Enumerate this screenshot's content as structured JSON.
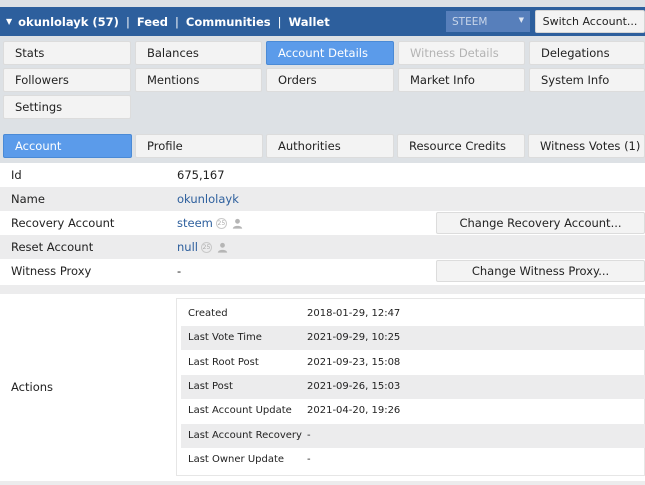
{
  "topbar": {
    "account": "okunlolayk (57)",
    "links": [
      "Feed",
      "Communities",
      "Wallet"
    ],
    "chain": "STEEM",
    "switch_label": "Switch Account..."
  },
  "nav": {
    "tabs": [
      {
        "label": "Stats"
      },
      {
        "label": "Balances"
      },
      {
        "label": "Account Details"
      },
      {
        "label": "Witness Details"
      },
      {
        "label": "Delegations"
      },
      {
        "label": "Followers"
      },
      {
        "label": "Mentions"
      },
      {
        "label": "Orders"
      },
      {
        "label": "Market Info"
      },
      {
        "label": "System Info"
      },
      {
        "label": "Settings"
      }
    ]
  },
  "subtabs": [
    {
      "label": "Account"
    },
    {
      "label": "Profile"
    },
    {
      "label": "Authorities"
    },
    {
      "label": "Resource Credits"
    },
    {
      "label": "Witness Votes (1)"
    }
  ],
  "details": {
    "id_label": "Id",
    "id_value": "675,167",
    "name_label": "Name",
    "name_value": "okunlolayk",
    "recovery_label": "Recovery Account",
    "recovery_value": "steem",
    "recovery_btn": "Change Recovery Account...",
    "reset_label": "Reset Account",
    "reset_value": "null",
    "proxy_label": "Witness Proxy",
    "proxy_value": "-",
    "proxy_btn": "Change Witness Proxy...",
    "actions_label": "Actions"
  },
  "actions": [
    {
      "key": "Created",
      "value": "2018-01-29, 12:47"
    },
    {
      "key": "Last Vote Time",
      "value": "2021-09-29, 10:25"
    },
    {
      "key": "Last Root Post",
      "value": "2021-09-23, 15:08"
    },
    {
      "key": "Last Post",
      "value": "2021-09-26, 15:03"
    },
    {
      "key": "Last Account Update",
      "value": "2021-04-20, 19:26"
    },
    {
      "key": "Last Account Recovery",
      "value": "-"
    },
    {
      "key": "Last Owner Update",
      "value": "-"
    }
  ],
  "colors": {
    "accent": "#2d5f9d",
    "active_tab": "#5b9bea"
  }
}
